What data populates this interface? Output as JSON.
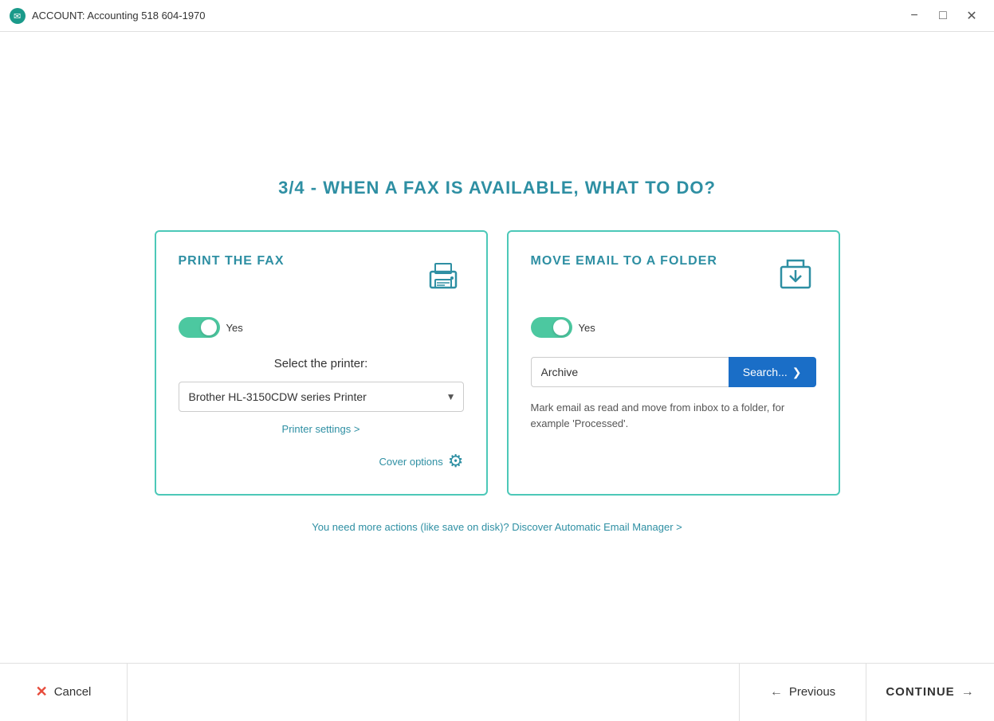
{
  "titlebar": {
    "title": "ACCOUNT: Accounting 518 604-1970",
    "minimize_label": "minimize",
    "maximize_label": "maximize",
    "close_label": "close"
  },
  "main": {
    "step_title": "3/4 - WHEN A FAX IS AVAILABLE, WHAT TO DO?",
    "print_card": {
      "title": "PRINT THE FAX",
      "toggle_state": "Yes",
      "select_label": "Select the printer:",
      "printer_value": "Brother HL-3150CDW series Printer",
      "printer_settings_link": "Printer settings >",
      "cover_options_label": "Cover options"
    },
    "email_card": {
      "title": "MOVE EMAIL TO A FOLDER",
      "toggle_state": "Yes",
      "folder_value": "Archive",
      "search_button_label": "Search...",
      "description": "Mark email as read and move from inbox to a folder, for example 'Processed'."
    },
    "discover_link": "You need more actions (like save on disk)? Discover Automatic Email Manager >"
  },
  "footer": {
    "cancel_label": "Cancel",
    "previous_label": "Previous",
    "continue_label": "CONTINUE"
  }
}
